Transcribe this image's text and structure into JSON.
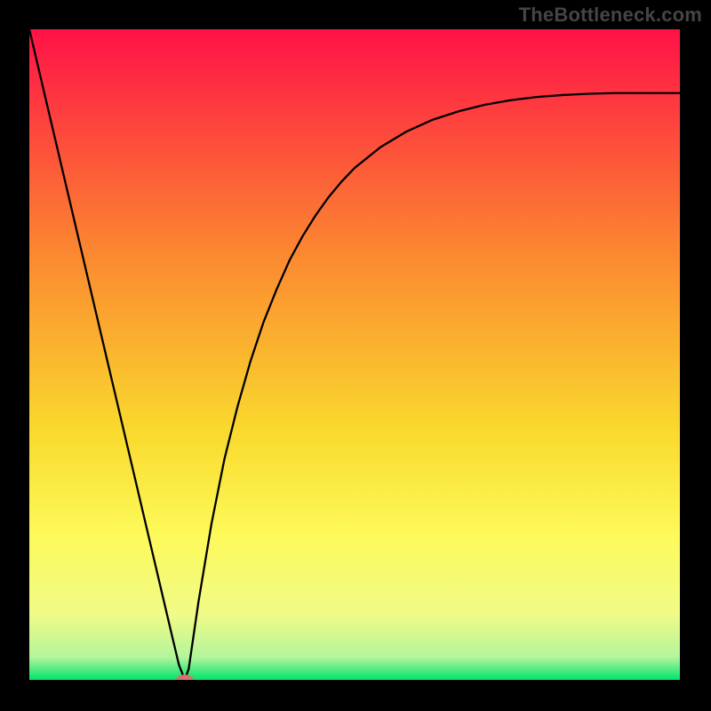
{
  "watermark": "TheBottleneck.com",
  "chart_data": {
    "type": "line",
    "title": "",
    "xlabel": "",
    "ylabel": "",
    "xlim": [
      0,
      100
    ],
    "ylim": [
      0,
      100
    ],
    "grid": false,
    "legend": false,
    "background": {
      "type": "vertical-gradient",
      "stops": [
        {
          "pos": 0.0,
          "color": "#ff1247"
        },
        {
          "pos": 0.35,
          "color": "#fb8a30"
        },
        {
          "pos": 0.62,
          "color": "#fada2d"
        },
        {
          "pos": 0.78,
          "color": "#fdfa5b"
        },
        {
          "pos": 0.9,
          "color": "#f0fb88"
        },
        {
          "pos": 0.965,
          "color": "#b3f59b"
        },
        {
          "pos": 1.0,
          "color": "#00e46b"
        }
      ]
    },
    "series": [
      {
        "name": "curve",
        "color": "#000000",
        "x": [
          0,
          2,
          4,
          6,
          8,
          10,
          12,
          14,
          16,
          18,
          20,
          22,
          23,
          23.9,
          24.5,
          26,
          28,
          30,
          32,
          34,
          36,
          38,
          40,
          42,
          44,
          46,
          48,
          50,
          54,
          58,
          62,
          66,
          70,
          74,
          78,
          82,
          86,
          90,
          94,
          98,
          100
        ],
        "y": [
          100,
          91.5,
          83,
          74.5,
          66,
          57.5,
          49,
          40.5,
          32,
          23.5,
          15,
          6.5,
          2.3,
          0,
          1.7,
          12,
          24,
          34,
          42,
          49,
          55,
          60,
          64.5,
          68.2,
          71.4,
          74.2,
          76.6,
          78.7,
          81.9,
          84.3,
          86.1,
          87.4,
          88.4,
          89.1,
          89.6,
          89.9,
          90.1,
          90.2,
          90.2,
          90.2,
          90.2
        ]
      }
    ],
    "marker": {
      "x": 23.9,
      "y": 0,
      "color": "#d6726c",
      "shape": "oval"
    }
  }
}
